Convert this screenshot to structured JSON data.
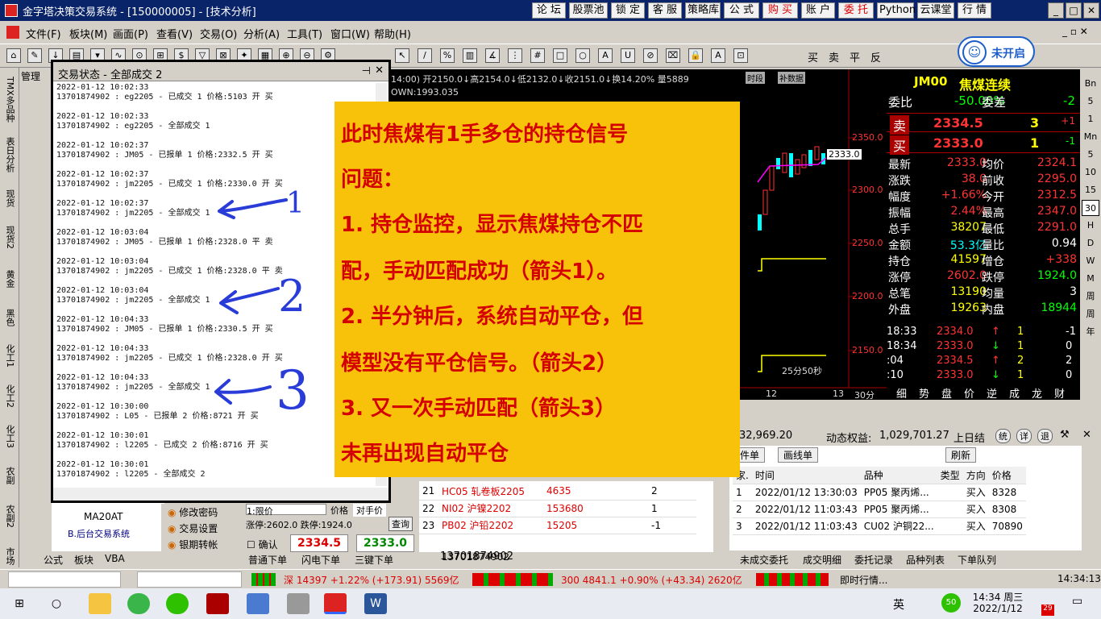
{
  "window": {
    "title": "金字塔决策交易系统 - [150000005] - [技术分析]"
  },
  "topbuttons": [
    "论 坛",
    "股票池",
    "锁 定",
    "客 服",
    "策略库",
    "公 式",
    "购 买",
    "账 户",
    "委 托",
    "Python",
    "云课堂",
    "行 情"
  ],
  "menu": [
    "文件(F)",
    "板块(M)",
    "画面(P)",
    "查看(V)",
    "交易(O)",
    "分析(A)",
    "工具(T)",
    "窗口(W)",
    "帮助(H)"
  ],
  "toolbar_right": [
    "买",
    "卖",
    "平",
    "反"
  ],
  "wechat": {
    "label": "未开启"
  },
  "left_tabs": [
    "TMX多品种交",
    "表日分析",
    "现货",
    "现货2",
    "黄金",
    "黑色",
    "化工1",
    "化工2",
    "化工3",
    "农副",
    "农副2",
    "市场"
  ],
  "left_tree": {
    "item": "MA20AT",
    "folder": "B.后台交易系统"
  },
  "dialog": {
    "title": "交易状态 - 全部成交 2",
    "entries": [
      [
        "2022-01-12 10:02:33",
        "13701874902 : eg2205 - 已成交 1 价格:5103 开 买"
      ],
      [
        "2022-01-12 10:02:33",
        "13701874902 : eg2205 - 全部成交 1"
      ],
      [
        "2022-01-12 10:02:37",
        "13701874902 : JM05 - 已报单 1 价格:2332.5 开 买"
      ],
      [
        "2022-01-12 10:02:37",
        "13701874902 : jm2205 - 已成交 1 价格:2330.0 开 买"
      ],
      [
        "2022-01-12 10:02:37",
        "13701874902 : jm2205 - 全部成交 1"
      ],
      [
        "2022-01-12 10:03:04",
        "13701874902 : JM05 - 已报单 1 价格:2328.0 平 卖"
      ],
      [
        "2022-01-12 10:03:04",
        "13701874902 : jm2205 - 已成交 1 价格:2328.0 平 卖"
      ],
      [
        "2022-01-12 10:03:04",
        "13701874902 : jm2205 - 全部成交 1"
      ],
      [
        "2022-01-12 10:04:33",
        "13701874902 : JM05 - 已报单 1 价格:2330.5 开 买"
      ],
      [
        "2022-01-12 10:04:33",
        "13701874902 : jm2205 - 已成交 1 价格:2328.0 开 买"
      ],
      [
        "2022-01-12 10:04:33",
        "13701874902 : jm2205 - 全部成交 1"
      ],
      [
        "2022-01-12 10:30:00",
        "13701874902 : L05 - 已报单 2 价格:8721 开 买"
      ],
      [
        "2022-01-12 10:30:01",
        "13701874902 : l2205 - 已成交 2 价格:8716 开 买"
      ],
      [
        "2022-01-12 10:30:01",
        "13701874902 : l2205 - 全部成交 2"
      ]
    ]
  },
  "chart_header": {
    "text": "14:00) 开2150.0↓高2154.0↓低2132.0↓收2151.0↓换14.20% 量5889",
    "tag1": "时段",
    "tag2": "补数据",
    "down": "OWN:1993.035",
    "y_labels": [
      "2350.0",
      "2300.0",
      "2250.0",
      "2200.0",
      "2150.0"
    ],
    "price_tag": "2333.0",
    "countdown": "25分50秒",
    "bottom_left": "12",
    "bottom_mid": "13",
    "bottom_right": "30分"
  },
  "quote": {
    "code": "JM00",
    "name": "焦煤连续",
    "weibi_label": "委比",
    "weibi": "-50.00%",
    "weicha_label": "委差",
    "weicha": "-2",
    "sell_label": "卖",
    "sell_price": "2334.5",
    "sell_vol": "3",
    "sell_chg": "+1",
    "buy_label": "买",
    "buy_price": "2333.0",
    "buy_vol": "1",
    "buy_chg": "-1",
    "rows": [
      [
        "最新",
        "2333.0",
        "均价",
        "2324.1"
      ],
      [
        "涨跌",
        "38.0",
        "前收",
        "2295.0"
      ],
      [
        "幅度",
        "+1.66%",
        "今开",
        "2312.5"
      ],
      [
        "振幅",
        "2.44%",
        "最高",
        "2347.0"
      ],
      [
        "总手",
        "38207",
        "最低",
        "2291.0"
      ],
      [
        "金额",
        "53.3亿",
        "量比",
        "0.94"
      ],
      [
        "持仓",
        "41597",
        "增仓",
        "+338"
      ],
      [
        "涨停",
        "2602.0",
        "跌停",
        "1924.0"
      ],
      [
        "总笔",
        "13190",
        "均量",
        "3"
      ],
      [
        "外盘",
        "19263",
        "内盘",
        "18944"
      ]
    ],
    "ticks": [
      [
        "18:33",
        "2334.0",
        "↑",
        "1",
        "-1"
      ],
      [
        "18:34",
        "2333.0",
        "↓",
        "1",
        "0"
      ],
      [
        ":04",
        "2334.5",
        "↑",
        "2",
        "2"
      ],
      [
        ":10",
        "2333.0",
        "↓",
        "1",
        "0"
      ]
    ],
    "tabs": [
      "细",
      "势",
      "盘",
      "价",
      "逆",
      "成",
      "龙",
      "财"
    ]
  },
  "right_tabs": [
    "Bn",
    "5",
    "1",
    "Mn",
    "5",
    "10",
    "15",
    "30",
    "H",
    "D",
    "W",
    "M",
    "周",
    "周",
    "年"
  ],
  "overlay": {
    "lines": [
      "此时焦煤有1手多仓的持仓信号",
      "问题：",
      "1. 持仓监控，显示焦煤持仓不匹",
      "配，手动匹配成功（箭头1）。",
      "2. 半分钟后，系统自动平仓，但",
      "模型没有平仓信号。（箭头2）",
      "3. 又一次手动匹配（箭头3）",
      "未再出现自动平仓"
    ],
    "arrow_nums": [
      "1",
      "2",
      "3"
    ]
  },
  "account": {
    "balance": "32,969.20",
    "equity_label": "动态权益:",
    "equity": "1,029,701.27",
    "prev_label": "上日结",
    "btns": [
      "统",
      "详",
      "退"
    ]
  },
  "order_tabs": [
    "件单",
    "画线单",
    "刷新"
  ],
  "orders": {
    "headers": [
      "家.",
      "时间",
      "品种",
      "类型",
      "方向",
      "价格"
    ],
    "rows": [
      [
        "1",
        "2022/01/12 13:30:03",
        "PP05 聚丙烯...",
        "",
        "买入",
        "8328"
      ],
      [
        "2",
        "2022/01/12 11:03:43",
        "PP05 聚丙烯...",
        "",
        "买入",
        "8308"
      ],
      [
        "3",
        "2022/01/12 11:03:43",
        "CU02 沪铜22...",
        "",
        "买入",
        "70890"
      ]
    ]
  },
  "positions": [
    [
      "21",
      "HC05 轧卷板2205",
      "4635",
      "2"
    ],
    [
      "22",
      "NI02 沪镍2202",
      "153680",
      "1"
    ],
    [
      "23",
      "PB02 沪铅2202",
      "15205",
      "-1"
    ]
  ],
  "account_id": "13701874902",
  "trade_panel": {
    "menu": [
      "修改密码",
      "交易设置",
      "银期转帐"
    ],
    "price_type": "1:限价",
    "price_label": "价格",
    "opp_label": "对手价",
    "limit_up": "涨停:2602.0 跌停:1924.0",
    "query": "查询",
    "confirm": "确认",
    "sell_price": "2334.5",
    "buy_price": "2333.0",
    "bottom_tabs": [
      "普通下单",
      "闪电下单",
      "三键下单"
    ]
  },
  "bottom_left_tabs": [
    "公式",
    "板块",
    "VBA"
  ],
  "bottom_right_tabs": [
    "未成交委托",
    "成交明细",
    "委托记录",
    "品种列表",
    "下单队列"
  ],
  "statusbar": {
    "sz": "深 14397 +1.22% (+173.91) 5569亿",
    "hs300": "300 4841.1 +0.90% (+43.34) 2620亿",
    "realtime": "即时行情...",
    "time": "14:34:13"
  },
  "taskbar": {
    "ime": "英",
    "clock_time": "14:34 周三",
    "clock_date": "2022/1/12",
    "badge": "50",
    "notif": "29"
  },
  "colors": {
    "red": "#ff2020",
    "green": "#00e040",
    "overlay": "#f9c20a"
  }
}
